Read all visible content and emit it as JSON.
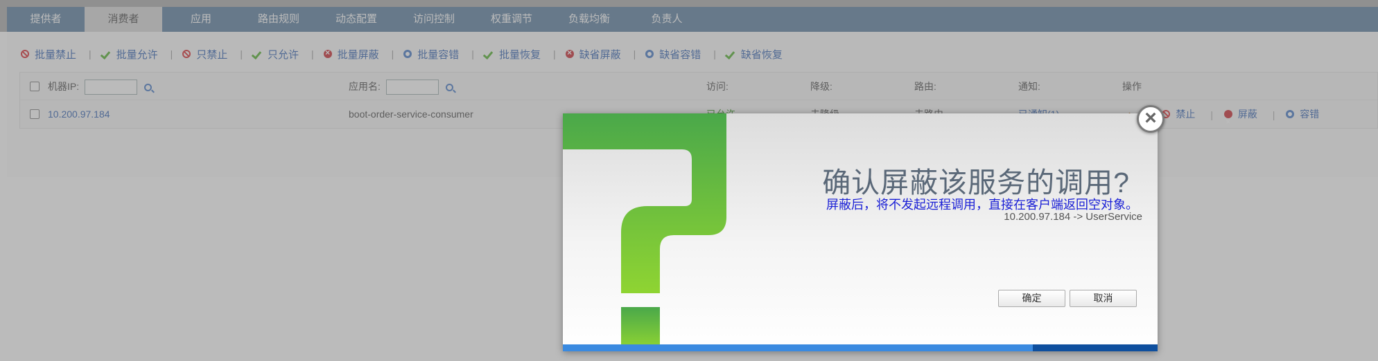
{
  "tabs": [
    "提供者",
    "消费者",
    "应用",
    "路由规则",
    "动态配置",
    "访问控制",
    "权重调节",
    "负载均衡",
    "负责人"
  ],
  "active_tab": "消费者",
  "toolbar": [
    {
      "label": "批量禁止",
      "icon": "ban-icon"
    },
    {
      "label": "批量允许",
      "icon": "check-icon"
    },
    {
      "label": "只禁止",
      "icon": "ban-icon"
    },
    {
      "label": "只允许",
      "icon": "check-icon"
    },
    {
      "label": "批量屏蔽",
      "icon": "x-circle-icon"
    },
    {
      "label": "批量容错",
      "icon": "gear-icon"
    },
    {
      "label": "批量恢复",
      "icon": "check-icon"
    },
    {
      "label": "缺省屏蔽",
      "icon": "x-circle-icon"
    },
    {
      "label": "缺省容错",
      "icon": "gear-icon"
    },
    {
      "label": "缺省恢复",
      "icon": "check-icon"
    }
  ],
  "table": {
    "header": {
      "ip_label": "机器IP:",
      "app_label": "应用名:",
      "access": "访问:",
      "degrade": "降级:",
      "route": "路由:",
      "notify": "通知:",
      "ops": "操作"
    },
    "rows": [
      {
        "ip": "10.200.97.184",
        "app": "boot-order-service-consumer",
        "access": "已允许",
        "degrade": "未降级",
        "route": "未路由",
        "notify": "已通知(1)",
        "ops": [
          "禁止",
          "屏蔽",
          "容错"
        ]
      }
    ]
  },
  "dialog": {
    "title": "确认屏蔽该服务的调用?",
    "message": "屏蔽后，将不发起远程调用，直接在客户端返回空对象。",
    "detail": "10.200.97.184 -> UserService",
    "ok_label": "确定",
    "cancel_label": "取消",
    "close_icon": "close-icon",
    "progress": 0.79
  },
  "colors": {
    "tab_bar": "#567a9c",
    "link": "#2a5db0",
    "message": "#1a1fd6",
    "progress_fill": "#3a8ae0",
    "progress_track": "#0e4f9e",
    "question_mark": "#5cb83c"
  }
}
